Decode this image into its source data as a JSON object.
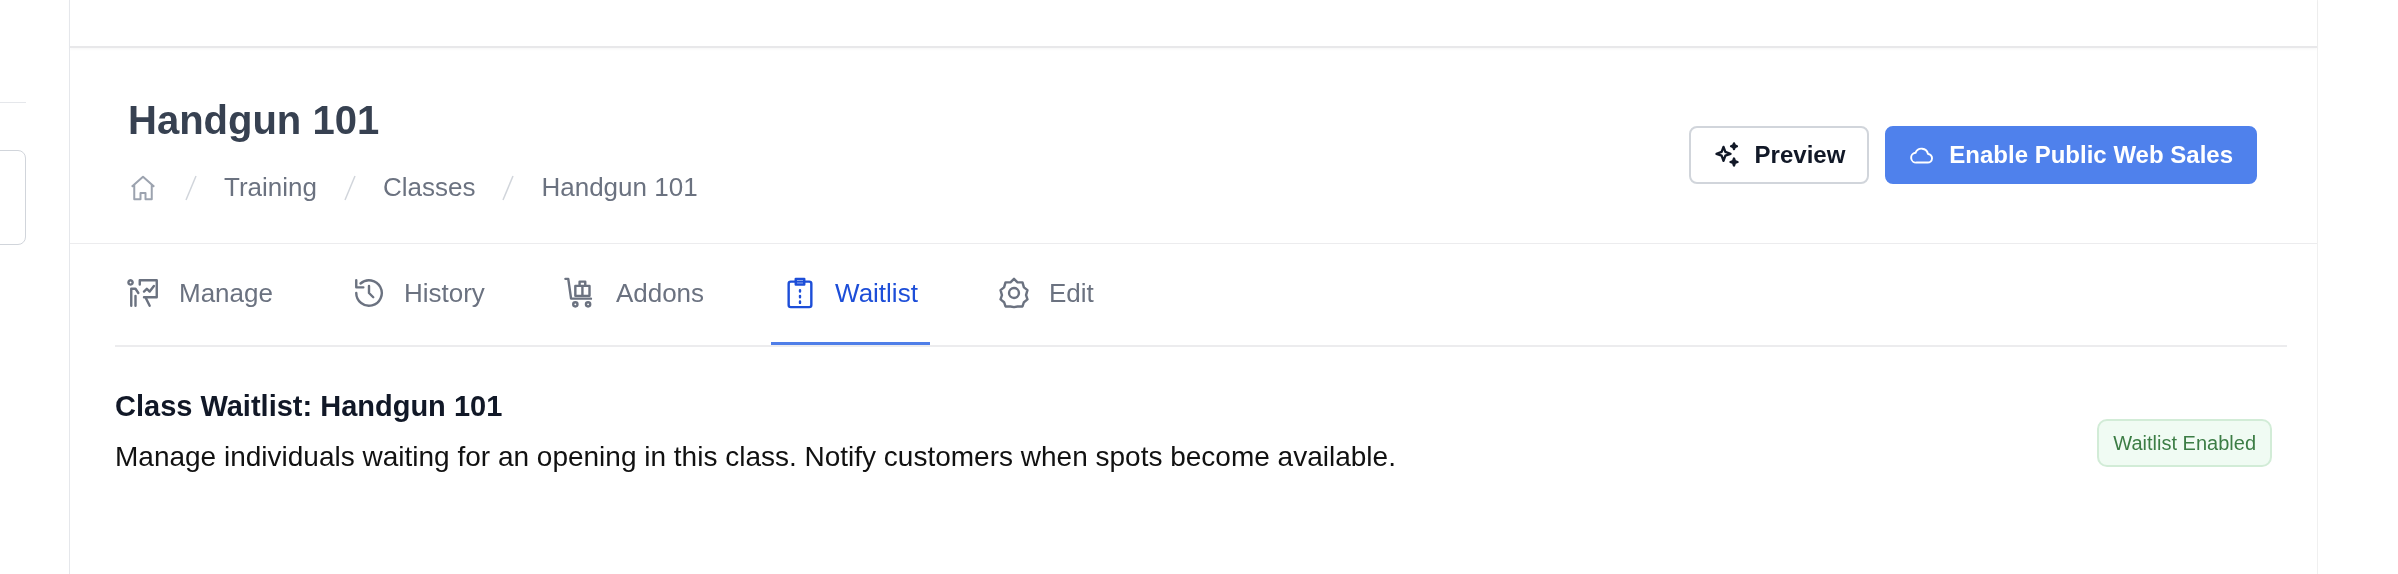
{
  "page": {
    "title": "Handgun 101"
  },
  "breadcrumb": [
    {
      "label": "Training"
    },
    {
      "label": "Classes"
    },
    {
      "label": "Handgun 101"
    }
  ],
  "actions": [
    {
      "kind": "outline",
      "label": "Preview"
    },
    {
      "kind": "primary",
      "label": "Enable Public Web Sales"
    }
  ],
  "tabs": [
    {
      "kind": "manage",
      "label": "Manage",
      "selected": false
    },
    {
      "kind": "history",
      "label": "History",
      "selected": false
    },
    {
      "kind": "addons",
      "label": "Addons",
      "selected": false
    },
    {
      "kind": "waitlist",
      "label": "Waitlist",
      "selected": true
    },
    {
      "kind": "edit",
      "label": "Edit",
      "selected": false
    }
  ],
  "section": {
    "title": "Class Waitlist: Handgun 101",
    "description": "Manage individuals waiting for an opening in this class. Notify customers when spots become available.",
    "badge": "Waitlist Enabled"
  }
}
